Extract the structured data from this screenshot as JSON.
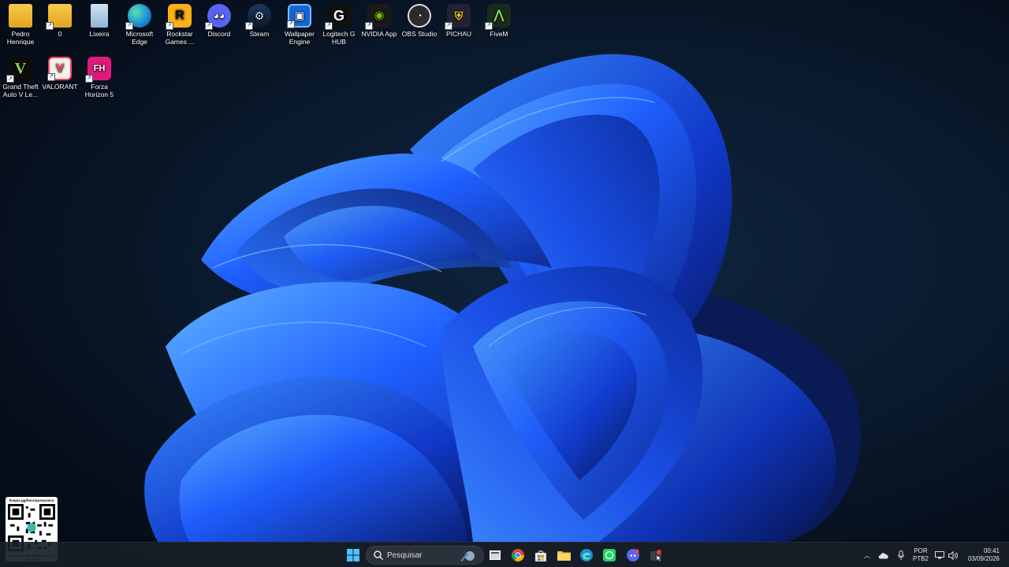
{
  "desktop": {
    "icons_row1": [
      {
        "label": "Pedro Henrique",
        "icon": "folder-icon"
      },
      {
        "label": "0",
        "icon": "folder-icon"
      },
      {
        "label": "Lixeira",
        "icon": "recycle-bin-icon"
      },
      {
        "label": "Microsoft Edge",
        "icon": "edge-icon"
      },
      {
        "label": "Rockstar Games ...",
        "icon": "rockstar-icon"
      },
      {
        "label": "Discord",
        "icon": "discord-icon"
      },
      {
        "label": "Steam",
        "icon": "steam-icon"
      },
      {
        "label": "Wallpaper Engine",
        "icon": "wallpaper-engine-icon"
      },
      {
        "label": "Logitech G HUB",
        "icon": "logitech-icon"
      },
      {
        "label": "NVIDIA App",
        "icon": "nvidia-icon"
      },
      {
        "label": "OBS Studio",
        "icon": "obs-icon"
      },
      {
        "label": "PICHAU",
        "icon": "pichau-icon"
      },
      {
        "label": "FiveM",
        "icon": "fivem-icon"
      }
    ],
    "icons_row2": [
      {
        "label": "Grand Theft Auto V Le...",
        "icon": "gta-icon"
      },
      {
        "label": "VALORANT",
        "icon": "valorant-icon"
      },
      {
        "label": "Forza Horizon 5",
        "icon": "forza-icon"
      }
    ]
  },
  "qr_overlay": {
    "top_text": "livepix.gg/henriquesaraiva",
    "bottom_text": "envie sua mensagem na live via pix!"
  },
  "taskbar": {
    "search_placeholder": "Pesquisar",
    "pinned": [
      "start-icon",
      "task-view-icon",
      "chrome-icon",
      "store-icon",
      "file-explorer-icon",
      "edge-icon",
      "whatsapp-icon",
      "discord-icon",
      "app-icon"
    ],
    "tray": {
      "language_line1": "POR",
      "language_line2": "PTB2",
      "time": "00:41",
      "date": "03/09/2026"
    }
  },
  "colors": {
    "accent_blue": "#1f5fff",
    "taskbar_bg": "#181e28"
  }
}
